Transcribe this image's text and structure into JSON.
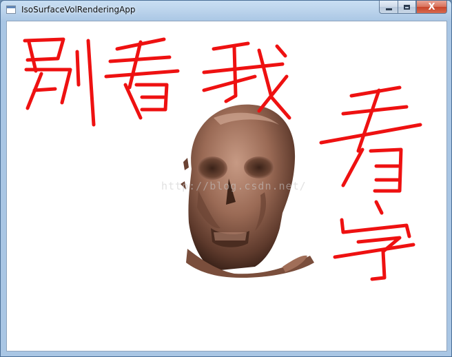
{
  "window": {
    "title": "IsoSurfaceVolRenderingApp",
    "close_label": "X"
  },
  "canvas": {
    "watermark": "http://blog.csdn.net/",
    "ink_color": "#ee1111",
    "skull_color": "#8a5a44"
  },
  "icons": [
    "app-icon",
    "minimize-icon",
    "maximize-icon",
    "close-icon"
  ]
}
